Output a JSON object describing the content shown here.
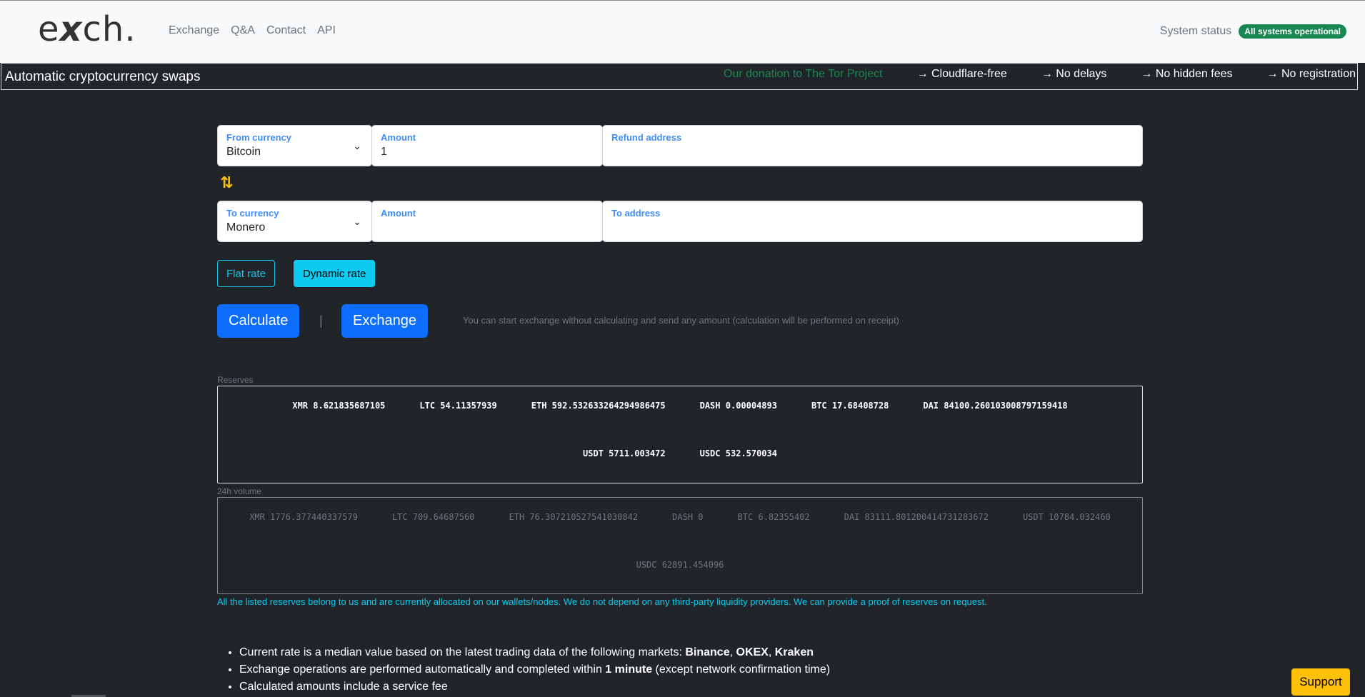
{
  "logo": {
    "pre": "e",
    "x": "x",
    "post": "ch."
  },
  "nav": [
    "Exchange",
    "Q&A",
    "Contact",
    "API"
  ],
  "system": {
    "label": "System status",
    "badge": "All systems operational",
    "badge_color": "#198754"
  },
  "banner": {
    "title": "Automatic cryptocurrency swaps",
    "donation": "Our donation to The Tor Project",
    "features": [
      "→ Cloudflare-free",
      "→ No delays",
      "→ No hidden fees",
      "→ No registration"
    ]
  },
  "form": {
    "from_currency": {
      "label": "From currency",
      "value": "Bitcoin"
    },
    "from_amount": {
      "label": "Amount",
      "value": "1"
    },
    "refund_address": {
      "label": "Refund address",
      "value": ""
    },
    "swap_icon": "⇅",
    "to_currency": {
      "label": "To currency",
      "value": "Monero"
    },
    "to_amount": {
      "label": "Amount",
      "value": ""
    },
    "to_address": {
      "label": "To address",
      "value": ""
    }
  },
  "rates": {
    "flat": "Flat rate",
    "dynamic": "Dynamic rate"
  },
  "actions": {
    "calculate": "Calculate",
    "separator": "|",
    "exchange": "Exchange",
    "hint": "You can start exchange without calculating and send any amount (calculation will be performed on receipt)"
  },
  "reserves": {
    "label": "Reserves",
    "items": [
      "XMR 8.621835687105",
      "LTC 54.11357939",
      "ETH 592.532633264294986475",
      "DASH 0.00004893",
      "BTC 17.68408728",
      "DAI 84100.260103008797159418",
      "USDT 5711.003472",
      "USDC 532.570034"
    ]
  },
  "volume": {
    "label": "24h volume",
    "items": [
      "XMR 1776.377440337579",
      "LTC 709.64687560",
      "ETH 76.307210527541030842",
      "DASH 0",
      "BTC 6.82355402",
      "DAI 83111.801200414731283672",
      "USDT 10784.032460",
      "USDC 62891.454096"
    ]
  },
  "reserves_note": "All the listed reserves belong to us and are currently allocated on our wallets/nodes. We do not depend on any third-party liquidity providers. We can provide a proof of reserves on request.",
  "info": {
    "line1_text": "Current rate is a median value based on the latest trading data of the following markets: ",
    "line1_markets": [
      "Binance",
      "OKEX",
      "Kraken"
    ],
    "line2_pre": "Exchange operations are performed automatically and completed within ",
    "line2_bold": "1 minute",
    "line2_post": " (except network confirmation time)",
    "line3": "Calculated amounts include a service fee"
  },
  "support": "Support"
}
